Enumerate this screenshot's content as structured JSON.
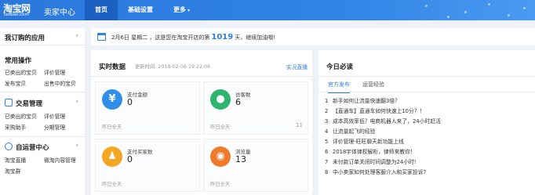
{
  "app": {
    "logo_main": "淘宝网",
    "logo_sub": "Taobao.com",
    "title": "卖家中心"
  },
  "nav": {
    "items": [
      {
        "label": "首页",
        "active": true
      },
      {
        "label": "基础设置",
        "active": false
      },
      {
        "label": "更多",
        "active": false,
        "caret": "▾"
      }
    ]
  },
  "sidebar": {
    "header": "我订购的应用",
    "header_arrow": "›",
    "sections": [
      {
        "title": "常用操作",
        "links": [
          "已卖出的宝贝",
          "评价管理",
          "发布宝贝",
          "出售中的宝贝"
        ]
      },
      {
        "title": "交易管理",
        "icon": "trade-icon",
        "arrow": "›",
        "links": [
          "已卖出的宝贝",
          "评价管理",
          "采购助手",
          "分期管理"
        ]
      },
      {
        "title": "自运营中心",
        "icon": "chat-icon",
        "arrow": "›",
        "links": [
          "淘宝直播",
          "微淘内容管理",
          "淘宝群"
        ]
      }
    ]
  },
  "notice": {
    "prefix": "2月6日 星期二 ，这是您在淘宝开店的第",
    "days": "1019",
    "suffix": "天，继续加油哦!"
  },
  "realtime": {
    "title": "实时数据",
    "updated": "更新时间: 2018-02-06 19:22:06",
    "live_link": "实况直播",
    "cards": [
      {
        "label": "支付金额",
        "value": "0",
        "foot": "昨日全天",
        "foot_value": "",
        "icon": "yen-icon",
        "icon_glyph": "¥",
        "color": "#2f8fe8"
      },
      {
        "label": "访客数",
        "value": "6",
        "foot": "昨日全天",
        "foot_value": "11",
        "icon": "visitors-icon",
        "icon_glyph": "●",
        "color": "#2fb56f"
      },
      {
        "label": "支付买家数",
        "value": "0",
        "foot": "昨日全天",
        "foot_value": "",
        "icon": "buyer-icon",
        "icon_glyph": "♟",
        "color": "#f5a623"
      },
      {
        "label": "浏览量",
        "value": "13",
        "foot": "昨日全天",
        "foot_value": "",
        "icon": "eye-icon",
        "icon_glyph": "◉",
        "color": "#f07a2c"
      }
    ]
  },
  "today": {
    "title": "今日必读",
    "tabs": [
      {
        "label": "官方发布",
        "active": true
      },
      {
        "label": "运营经验",
        "active": false
      }
    ],
    "news": [
      "新手如何让流量快速翻3倍？",
      "【直通车】直通车如何快速上10分？！",
      "成本高效率低？电商机器人来了，24小时赶活",
      "让流量起飞的经验",
      "评价管理-旺旺聊天新功能上线",
      "2018宇体律权解析，律师来教你！",
      "未付款订单关闭时间调整为24小时!",
      "中小卖家如何处理客服介入和买家投诉?"
    ]
  },
  "colors": {
    "brand": "#2f7fe0",
    "nav_active": "#1b5fc0",
    "page_bg": "#eef1f6"
  }
}
